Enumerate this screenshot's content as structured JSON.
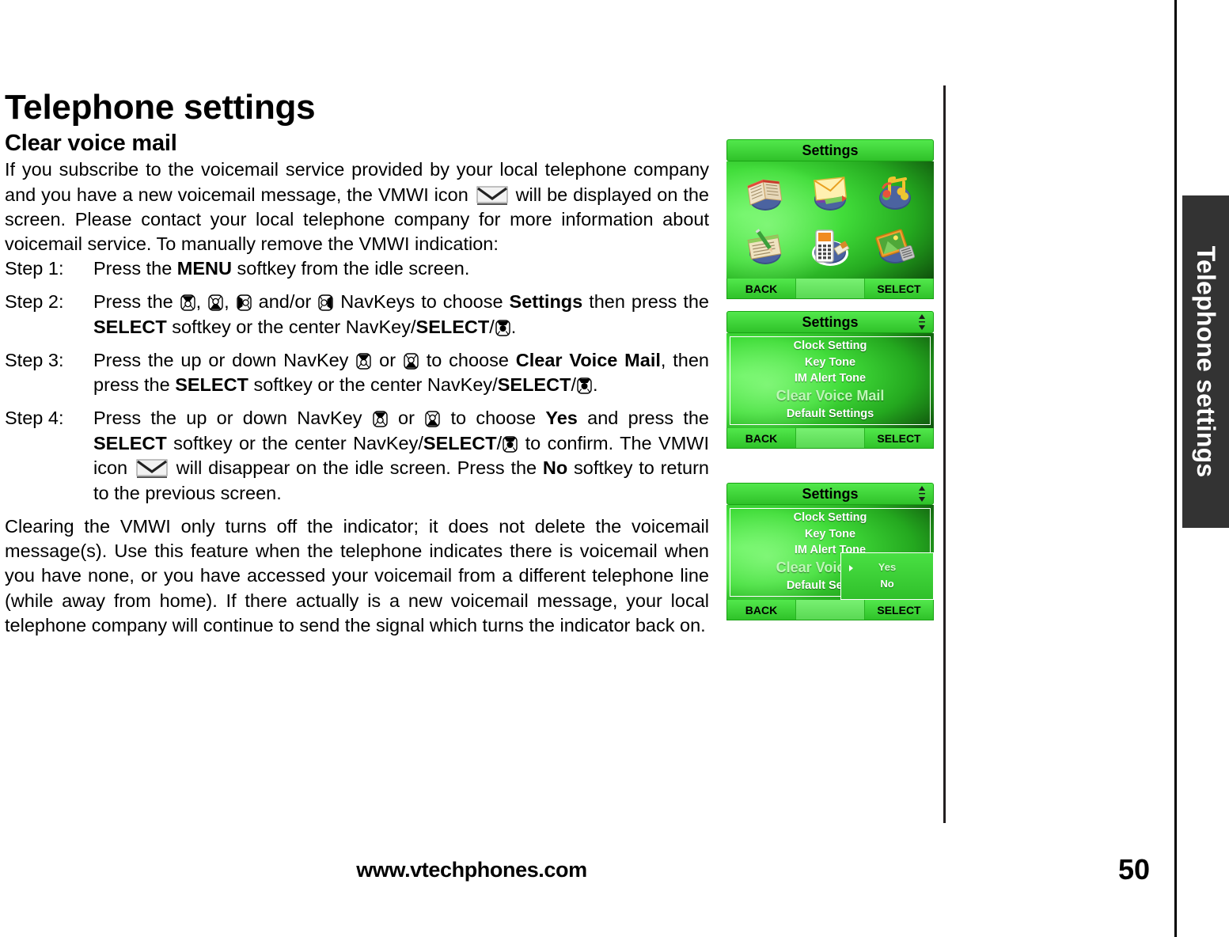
{
  "page": {
    "title": "Telephone settings",
    "section_title": "Clear voice mail",
    "intro": "If you subscribe to the voicemail service provided by your local telephone company and you have a new voicemail message, the VMWI icon   will be displayed on the screen. Please contact your local telephone company for more information about voicemail service. To manually remove the VMWI indication:",
    "intro_part1": "If you subscribe to the voicemail service provided by your local telephone company and you have a new voicemail message, the VMWI icon",
    "intro_part2": "will be displayed on the screen. Please contact your local telephone company for more information about voicemail service. To manually remove the VMWI indication:",
    "closing": "Clearing the VMWI only turns off the indicator; it does not delete the voicemail message(s). Use this feature when the telephone indicates there is voicemail when you have none, or you have accessed your voicemail from a different telephone line (while away from home). If there actually is a new voicemail message, your local telephone company will continue to send the signal which turns the indicator back on.",
    "side_tab_label": "Telephone settings",
    "footer_url": "www.vtechphones.com",
    "page_number": "50"
  },
  "steps": [
    {
      "label": "Step 1:",
      "t1": "Press the ",
      "b1": "MENU",
      "t2": " softkey from the idle screen."
    },
    {
      "label": "Step 2:",
      "t1": "Press the ",
      "sep1": ", ",
      "sep2": ", ",
      "t2": " and/or ",
      "t3": " NavKeys to choose ",
      "b1": "Settings",
      "t4": " then press the ",
      "b2": "SELECT",
      "t5": " softkey or the center NavKey/",
      "b3": "SELECT",
      "t6": "/",
      "t7": "."
    },
    {
      "label": "Step 3:",
      "t1": "Press the up or down NavKey ",
      "t2": " or ",
      "t3": " to choose ",
      "b1": "Clear Voice Mail",
      "t4": ", then press the ",
      "b2": "SELECT",
      "t5": " softkey or the center NavKey/",
      "b3": "SELECT",
      "t6": "/",
      "t7": "."
    },
    {
      "label": "Step 4:",
      "t1": "Press the up or down NavKey ",
      "t2": " or ",
      "t3": " to choose ",
      "b1": "Yes",
      "t4": " and press the ",
      "b2": "SELECT",
      "t5": " softkey or the center NavKey/",
      "b3": "SELECT",
      "t6": "/",
      "t7": " to confirm. The VMWI icon ",
      "t8": " will disappear on the idle screen. Press the ",
      "b4": "No",
      "t9": " softkey to return to the previous screen."
    }
  ],
  "screens": {
    "screen1": {
      "title": "Settings",
      "icons": [
        "phonebook-icon",
        "message-envelope-icon",
        "music-note-icon",
        "notepad-pen-icon",
        "handset-settings-icon",
        "picture-gallery-icon"
      ],
      "softkey_left": "BACK",
      "softkey_mid": "",
      "softkey_right": "SELECT"
    },
    "screen2": {
      "title": "Settings",
      "items": [
        "Clock Setting",
        "Key Tone",
        "IM Alert Tone",
        "Clear Voice Mail",
        "Default Settings"
      ],
      "selected": "Clear Voice Mail",
      "softkey_left": "BACK",
      "softkey_mid": "",
      "softkey_right": "SELECT"
    },
    "screen3": {
      "title": "Settings",
      "items": [
        "Clock Setting",
        "Key Tone",
        "IM Alert Tone",
        "Clear Voice Mail",
        "Default Settings"
      ],
      "selected": "Clear Voice Mail",
      "submenu": [
        "Yes",
        "No"
      ],
      "submenu_selected": "Yes",
      "softkey_left": "BACK",
      "softkey_mid": "",
      "softkey_right": "SELECT"
    }
  },
  "colors": {
    "screen_green": "#3fd939",
    "screen_dark_green": "#0c3b08",
    "tab_dark": "#333333",
    "selected_text": "#bdf7b6"
  }
}
